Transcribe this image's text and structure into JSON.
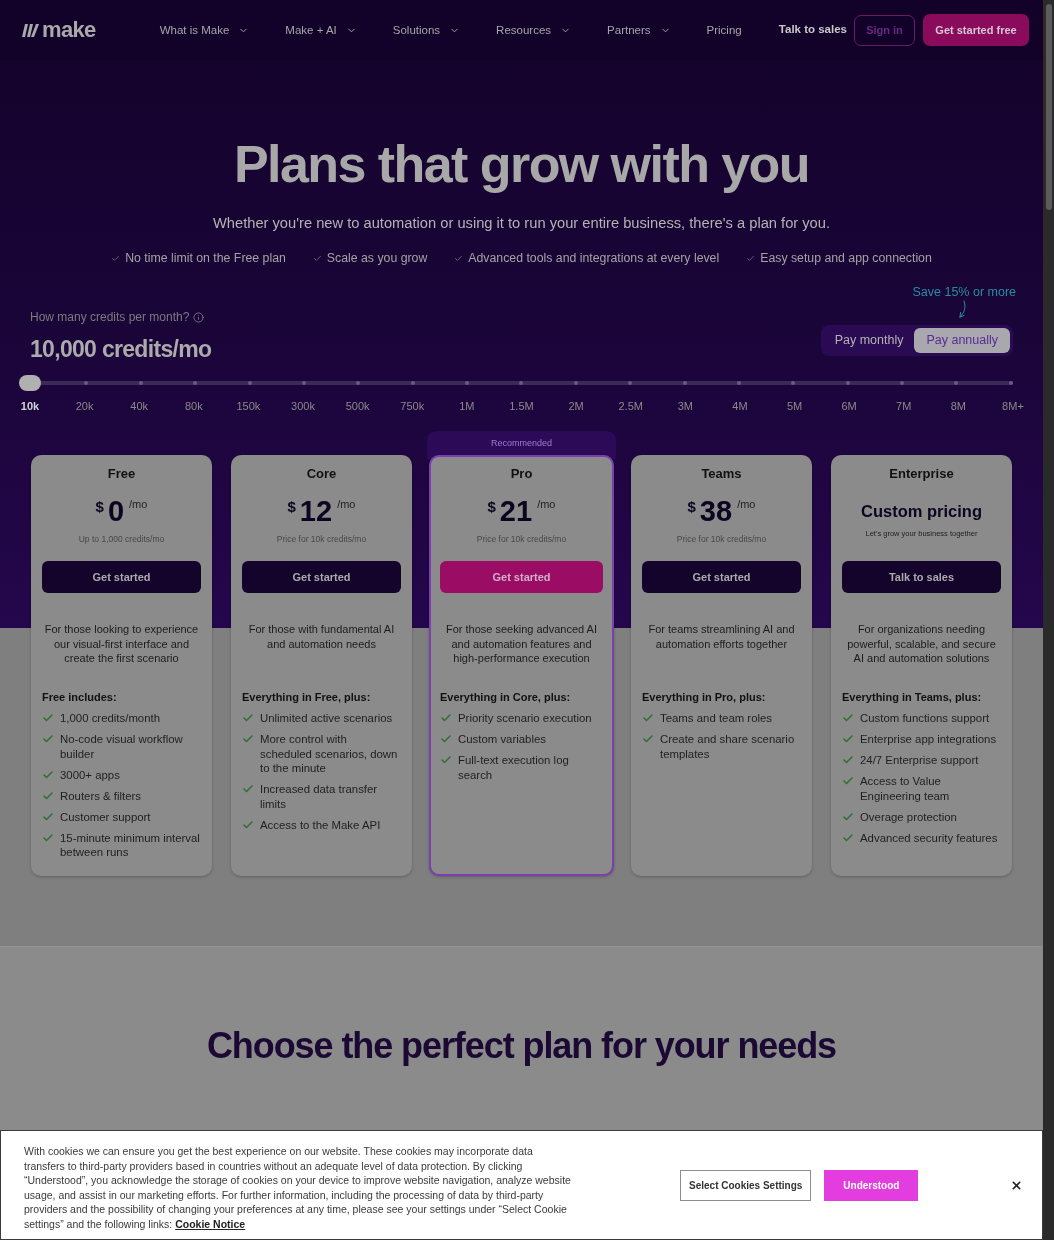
{
  "nav": {
    "logo": "make",
    "items": [
      {
        "label": "What is Make",
        "dropdown": true
      },
      {
        "label": "Make + AI",
        "dropdown": true
      },
      {
        "label": "Solutions",
        "dropdown": true
      },
      {
        "label": "Resources",
        "dropdown": true
      },
      {
        "label": "Partners",
        "dropdown": true
      },
      {
        "label": "Pricing",
        "dropdown": false
      }
    ],
    "talk_to_sales": "Talk to sales",
    "sign_in": "Sign in",
    "cta": "Get started free"
  },
  "hero": {
    "title": "Plans that grow with you",
    "subtitle": "Whether you're new to automation or using it to run your entire business, there's a plan for you.",
    "highlights": [
      "No time limit on the Free plan",
      "Scale as you grow",
      "Advanced tools and integrations at every level",
      "Easy setup and app connection"
    ]
  },
  "credits": {
    "question": "How many credits per month?",
    "value": "10,000 credits/mo",
    "level": 0,
    "stops": [
      {
        "label": "10k",
        "selected": true
      },
      {
        "label": "20k",
        "selected": false
      },
      {
        "label": "40k",
        "selected": false
      },
      {
        "label": "80k",
        "selected": false
      },
      {
        "label": "150k",
        "selected": false
      },
      {
        "label": "300k",
        "selected": false
      },
      {
        "label": "500k",
        "selected": false
      },
      {
        "label": "750k",
        "selected": false
      },
      {
        "label": "1M",
        "selected": false
      },
      {
        "label": "1.5M",
        "selected": false
      },
      {
        "label": "2M",
        "selected": false
      },
      {
        "label": "2.5M",
        "selected": false
      },
      {
        "label": "3M",
        "selected": false
      },
      {
        "label": "4M",
        "selected": false
      },
      {
        "label": "5M",
        "selected": false
      },
      {
        "label": "6M",
        "selected": false
      },
      {
        "label": "7M",
        "selected": false
      },
      {
        "label": "8M",
        "selected": false
      },
      {
        "label": "8M+",
        "selected": false
      }
    ]
  },
  "billing": {
    "note": "Save 15% or more",
    "options": [
      {
        "label": "Pay monthly",
        "selected": false
      },
      {
        "label": "Pay annually",
        "selected": true
      }
    ]
  },
  "plans": [
    {
      "name": "Free",
      "recommended": false,
      "price": {
        "kind": "amount",
        "currency": "$",
        "amount": "0",
        "period": "/mo"
      },
      "note": "Up to 1,000 credits/mo",
      "button": {
        "label": "Get started",
        "kind": "dark"
      },
      "description": "For those looking to experience our visual-first interface and create the first scenario",
      "features_heading": "Free includes:",
      "features": [
        "1,000 credits/month",
        "No-code visual workflow builder",
        "3000+ apps",
        "Routers & filters",
        "Customer support",
        "15-minute minimum interval between runs"
      ]
    },
    {
      "name": "Core",
      "recommended": false,
      "price": {
        "kind": "amount",
        "currency": "$",
        "amount": "12",
        "period": "/mo"
      },
      "note": "Price for 10k credits/mo",
      "button": {
        "label": "Get started",
        "kind": "dark"
      },
      "description": "For those with fundamental AI and automation needs",
      "features_heading": "Everything in Free, plus:",
      "features": [
        "Unlimited active scenarios",
        "More control with scheduled scenarios, down to the minute",
        "Increased data transfer limits",
        "Access to the Make API"
      ]
    },
    {
      "name": "Pro",
      "recommended": true,
      "badge": "Recommended",
      "price": {
        "kind": "amount",
        "currency": "$",
        "amount": "21",
        "period": "/mo"
      },
      "note": "Price for 10k credits/mo",
      "button": {
        "label": "Get started",
        "kind": "accent"
      },
      "description": "For those seeking advanced AI and automation features and high-performance execution",
      "features_heading": "Everything in Core, plus:",
      "features": [
        "Priority scenario execution",
        "Custom variables",
        "Full-text execution log search"
      ]
    },
    {
      "name": "Teams",
      "recommended": false,
      "price": {
        "kind": "amount",
        "currency": "$",
        "amount": "38",
        "period": "/mo"
      },
      "note": "Price for 10k credits/mo",
      "button": {
        "label": "Get started",
        "kind": "dark"
      },
      "description": "For teams streamlining AI and automation efforts together",
      "features_heading": "Everything in Pro, plus:",
      "features": [
        "Teams and team roles",
        "Create and share scenario templates"
      ]
    },
    {
      "name": "Enterprise",
      "recommended": false,
      "price": {
        "kind": "custom",
        "text": "Custom pricing"
      },
      "note": "Let's grow your business together",
      "button": {
        "label": "Talk to sales",
        "kind": "dark"
      },
      "description": "For organizations needing powerful, scalable, and secure AI and automation solutions",
      "features_heading": "Everything in Teams, plus:",
      "features": [
        "Custom functions support",
        "Enterprise app integrations",
        "24/7 Enterprise support",
        "Access to Value Engineering team",
        "Overage protection",
        "Advanced security features"
      ]
    }
  ],
  "section": {
    "heading": "Choose the perfect plan for your needs"
  },
  "cookie_banner": {
    "text": "With cookies we can ensure you get the best experience on our website. These cookies may incorporate data transfers to third-party providers based in countries without an adequate level of data protection. By clicking “Understood”, you acknowledge the storage of cookies on your device to improve website navigation, analyze website usage, and assist in our marketing efforts. For further information, including the processing of data by third-party providers and the possibility of changing your preferences at any time, please see your settings under “Select Cookie settings” and the following links:",
    "link": "Cookie Notice",
    "buttons": [
      {
        "label": "Select Cookies Settings",
        "kind": "outline"
      },
      {
        "label": "Understood",
        "kind": "primary"
      }
    ]
  }
}
